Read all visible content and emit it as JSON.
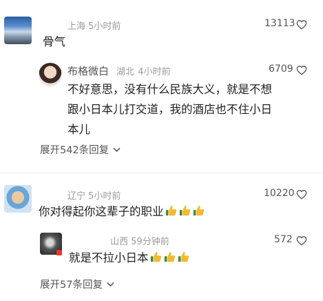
{
  "comments": [
    {
      "location": "上海",
      "time": "5小时前",
      "likes": "13113",
      "text": "骨气",
      "reply": {
        "name": "布格微白",
        "location": "湖北",
        "time": "4小时前",
        "likes": "6709",
        "text_lines": [
          "不好意思，没有什么民族大义，就是不想",
          "跟小日本儿打交道，我的酒店也不住小日",
          "本儿"
        ]
      },
      "expand": "展开542条回复"
    },
    {
      "location": "辽宁",
      "time": "5小时前",
      "likes": "10220",
      "text": "你对得起你这辈子的职业",
      "emoji_count": 3,
      "reply": {
        "location": "山西",
        "time": "59分钟前",
        "likes": "572",
        "text": "就是不拉小日本",
        "emoji_count": 3
      },
      "expand": "展开57条回复"
    }
  ],
  "icons": {
    "like": "heart-outline-icon",
    "expand": "chevron-down-icon",
    "emoji": "thumbs-up-emoji"
  },
  "colors": {
    "meta": "#9a9a9a",
    "text": "#222222",
    "emoji": "#f5b92c"
  }
}
